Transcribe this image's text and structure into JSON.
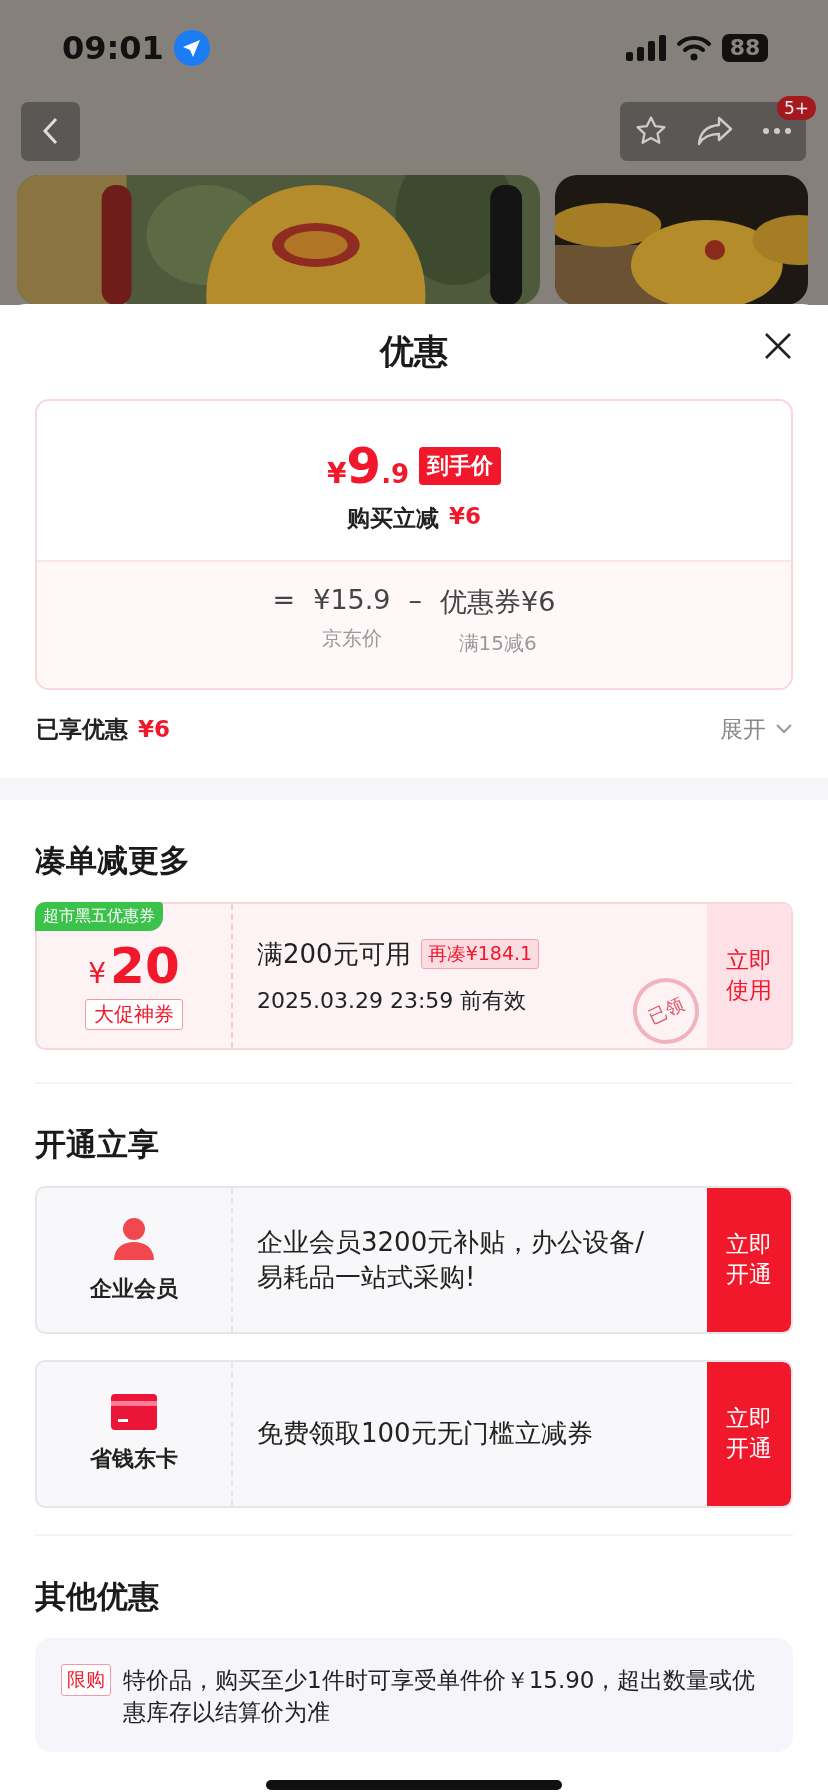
{
  "status_bar": {
    "time": "09:01",
    "battery": "88"
  },
  "nav": {
    "badge": "5+"
  },
  "sheet": {
    "title": "优惠"
  },
  "price_card": {
    "currency": "¥",
    "price_int": "9",
    "price_dec": ".9",
    "price_tag": "到手价",
    "saving_label": "购买立减",
    "saving_value": "¥6",
    "formula": [
      {
        "kind": "operator",
        "text": "="
      },
      {
        "kind": "term",
        "text": "¥15.9",
        "caption": "京东价"
      },
      {
        "kind": "operator",
        "text": "–"
      },
      {
        "kind": "term",
        "text": "优惠券¥6",
        "caption": "满15减6"
      }
    ]
  },
  "enjoyed": {
    "label": "已享优惠",
    "value": "¥6",
    "toggle": "展开",
    "expanded": false
  },
  "coupon_section": {
    "title": "凑单减更多",
    "coupons": [
      {
        "ribbon": "超市黑五优惠券",
        "currency": "¥",
        "amount": "20",
        "tag": "大促神券",
        "condition": "满200元可用",
        "gap": "再凑¥184.1",
        "expiry": "2025.03.29 23:59 前有效",
        "stamp": "已领",
        "action": "立即使用"
      }
    ]
  },
  "membership_section": {
    "title": "开通立享",
    "offers": [
      {
        "kind": "member",
        "name": "企业会员",
        "text": "企业会员3200元补贴，办公设备/易耗品一站式采购!",
        "action": "立即开通"
      },
      {
        "kind": "card",
        "name": "省钱东卡",
        "text": "免费领取100元无门槛立减券",
        "action": "立即开通"
      }
    ]
  },
  "other_section": {
    "title": "其他优惠",
    "notes": [
      {
        "tag": "限购",
        "text": "特价品，购买至少1件时可享受单件价￥15.90，超出数量或优惠库存以结算价为准"
      }
    ]
  }
}
